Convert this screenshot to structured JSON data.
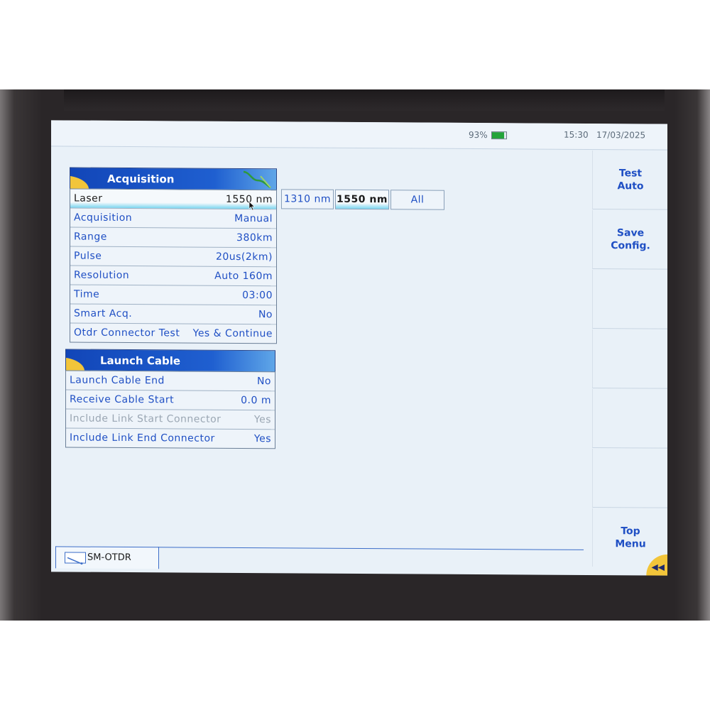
{
  "status": {
    "battery_percent": "93%",
    "battery_level": 0.93,
    "time": "15:30",
    "date": "17/03/2025"
  },
  "acquisition": {
    "title": "Acquisition",
    "rows": [
      {
        "label": "Laser",
        "value": "1550 nm"
      },
      {
        "label": "Acquisition",
        "value": "Manual"
      },
      {
        "label": "Range",
        "value": "380km"
      },
      {
        "label": "Pulse",
        "value": "20us(2km)"
      },
      {
        "label": "Resolution",
        "value": "Auto 160m"
      },
      {
        "label": "Time",
        "value": "03:00"
      },
      {
        "label": "Smart Acq.",
        "value": "No"
      },
      {
        "label": "Otdr Connector Test",
        "value": "Yes & Continue"
      }
    ]
  },
  "laser_options": [
    "1310 nm",
    "1550 nm",
    "All"
  ],
  "launch_cable": {
    "title": "Launch Cable",
    "rows": [
      {
        "label": "Launch Cable End",
        "value": "No"
      },
      {
        "label": "Receive Cable Start",
        "value": "0.0 m"
      },
      {
        "label": "Include Link Start Connector",
        "value": "Yes"
      },
      {
        "label": "Include Link End Connector",
        "value": "Yes"
      }
    ]
  },
  "softkeys": {
    "test_line1": "Test",
    "test_line2": "Auto",
    "save_line1": "Save",
    "save_line2": "Config.",
    "top_line1": "Top",
    "top_line2": "Menu"
  },
  "tab": {
    "label": "SM-OTDR"
  },
  "colors": {
    "header_blue": "#1f5fd0",
    "accent_yellow": "#f2c53a",
    "text_blue": "#1f4fc4",
    "selection_cyan": "#7ad6f0"
  }
}
